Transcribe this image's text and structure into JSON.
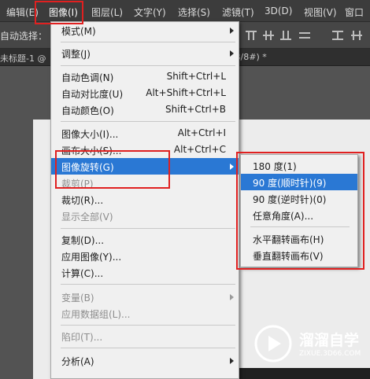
{
  "menubar": {
    "items": [
      "编辑(E)",
      "图像(I)",
      "图层(L)",
      "文字(Y)",
      "选择(S)",
      "滤镜(T)",
      "3D(D)",
      "视图(V)",
      "窗口"
    ]
  },
  "options_bar": {
    "label": "自动选择："
  },
  "doc_tabs": {
    "left_tab": "未标题-1 @",
    "right_tab": "B/8#) *"
  },
  "image_menu": {
    "items": [
      {
        "label": "模式(M)",
        "shortcut": "",
        "submenu": true,
        "disabled": false
      },
      {
        "label": "调整(J)",
        "shortcut": "",
        "submenu": true,
        "disabled": false
      },
      {
        "label": "自动色调(N)",
        "shortcut": "Shift+Ctrl+L",
        "submenu": false,
        "disabled": false
      },
      {
        "label": "自动对比度(U)",
        "shortcut": "Alt+Shift+Ctrl+L",
        "submenu": false,
        "disabled": false
      },
      {
        "label": "自动颜色(O)",
        "shortcut": "Shift+Ctrl+B",
        "submenu": false,
        "disabled": false
      },
      {
        "label": "图像大小(I)...",
        "shortcut": "Alt+Ctrl+I",
        "submenu": false,
        "disabled": false
      },
      {
        "label": "画布大小(S)...",
        "shortcut": "Alt+Ctrl+C",
        "submenu": false,
        "disabled": false
      },
      {
        "label": "图像旋转(G)",
        "shortcut": "",
        "submenu": true,
        "disabled": false,
        "highlighted": true
      },
      {
        "label": "裁剪(P)",
        "shortcut": "",
        "submenu": false,
        "disabled": true
      },
      {
        "label": "裁切(R)...",
        "shortcut": "",
        "submenu": false,
        "disabled": false
      },
      {
        "label": "显示全部(V)",
        "shortcut": "",
        "submenu": false,
        "disabled": true
      },
      {
        "label": "复制(D)...",
        "shortcut": "",
        "submenu": false,
        "disabled": false
      },
      {
        "label": "应用图像(Y)...",
        "shortcut": "",
        "submenu": false,
        "disabled": false
      },
      {
        "label": "计算(C)...",
        "shortcut": "",
        "submenu": false,
        "disabled": false
      },
      {
        "label": "变量(B)",
        "shortcut": "",
        "submenu": true,
        "disabled": true
      },
      {
        "label": "应用数据组(L)...",
        "shortcut": "",
        "submenu": false,
        "disabled": true
      },
      {
        "label": "陷印(T)...",
        "shortcut": "",
        "submenu": false,
        "disabled": true
      },
      {
        "label": "分析(A)",
        "shortcut": "",
        "submenu": true,
        "disabled": false
      }
    ]
  },
  "rotate_submenu": {
    "items": [
      {
        "label": "180 度(1)",
        "highlighted": false
      },
      {
        "label": "90 度(顺时针)(9)",
        "highlighted": true
      },
      {
        "label": "90 度(逆时针)(0)",
        "highlighted": false
      },
      {
        "label": "任意角度(A)...",
        "highlighted": false
      },
      {
        "label": "水平翻转画布(H)",
        "highlighted": false
      },
      {
        "label": "垂直翻转画布(V)",
        "highlighted": false
      }
    ]
  },
  "watermark": {
    "text": "溜溜自学",
    "url": "ZIXUE.3D66.COM"
  },
  "colors": {
    "highlight": "#2a78d4",
    "annotation": "#e02020",
    "menu_bg": "#f0f0f0"
  }
}
